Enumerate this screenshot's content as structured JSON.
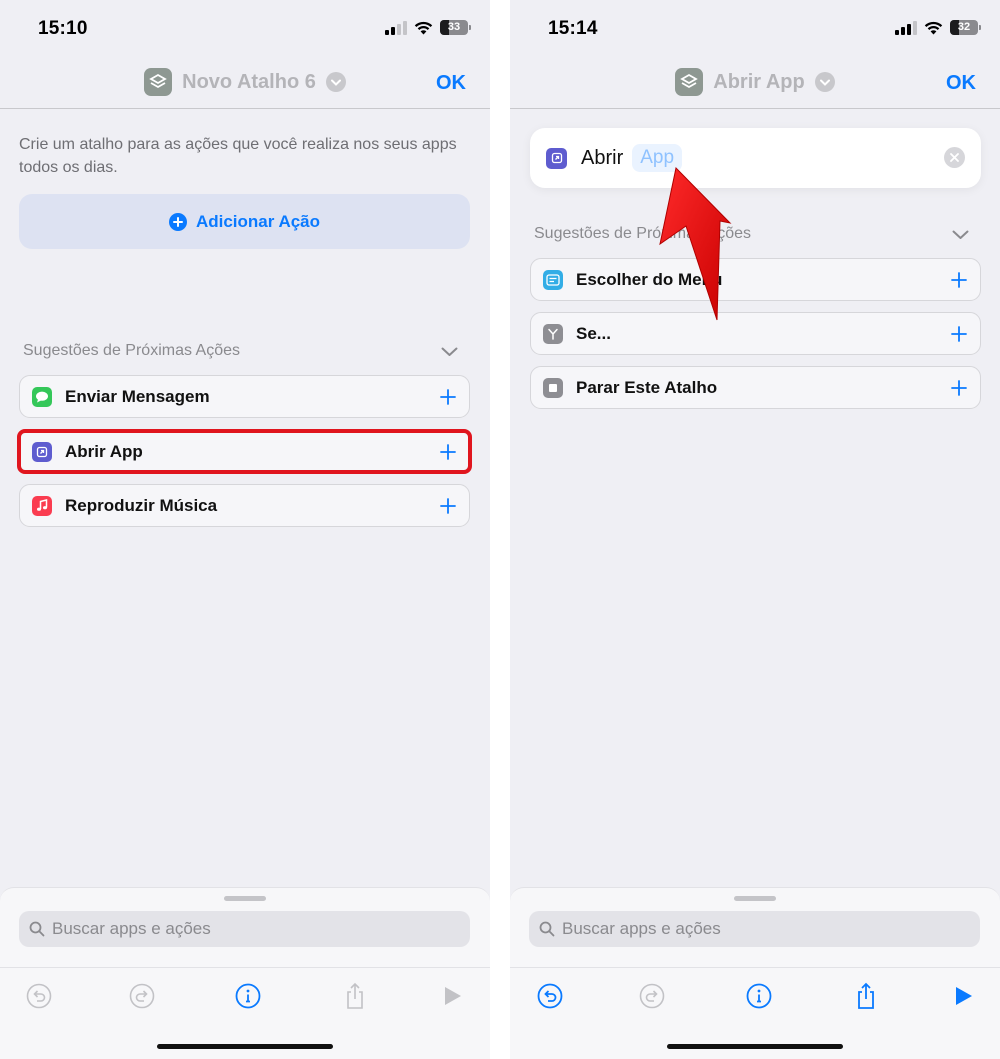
{
  "left_screen": {
    "status": {
      "time": "15:10",
      "battery": "33"
    },
    "nav": {
      "title": "Novo Atalho 6",
      "done": "OK"
    },
    "intro": "Crie um atalho para as ações que você realiza nos seus apps todos os dias.",
    "add_action": "Adicionar Ação",
    "suggestions_title": "Sugestões de Próximas Ações",
    "suggestions": [
      {
        "label": "Enviar Mensagem",
        "icon": "messages-icon",
        "color": "#34c759"
      },
      {
        "label": "Abrir App",
        "icon": "open-app-icon",
        "color": "#5e5ccf"
      },
      {
        "label": "Reproduzir Música",
        "icon": "music-icon",
        "color": "#fa3c50"
      }
    ],
    "search_placeholder": "Buscar apps e ações"
  },
  "right_screen": {
    "status": {
      "time": "15:14",
      "battery": "32"
    },
    "nav": {
      "title": "Abrir App",
      "done": "OK"
    },
    "action": {
      "verb": "Abrir",
      "param": "App"
    },
    "suggestions_title": "Sugestões de Próximas Ações",
    "suggestions": [
      {
        "label": "Escolher do Menu",
        "icon": "menu-icon",
        "color": "#32ade6"
      },
      {
        "label": "Se...",
        "icon": "if-icon",
        "color": "#8e8e93"
      },
      {
        "label": "Parar Este Atalho",
        "icon": "stop-icon",
        "color": "#8e8e93"
      }
    ],
    "search_placeholder": "Buscar apps e ações"
  },
  "colors": {
    "accent": "#0a7aff",
    "highlight": "#e0151e"
  }
}
